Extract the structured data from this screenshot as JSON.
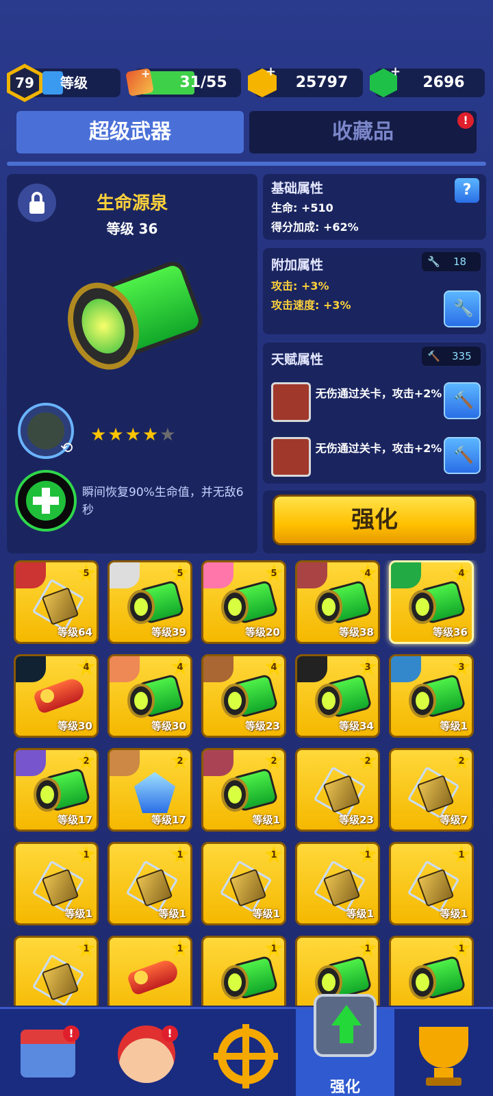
{
  "top_bar": {
    "level": "79",
    "level_label": "等级",
    "energy": "31/55",
    "energy_fill": 0.56,
    "gold": "25797",
    "gems": "2696"
  },
  "tabs": [
    {
      "label": "超级武器",
      "active": true
    },
    {
      "label": "收藏品",
      "active": false
    }
  ],
  "weapon": {
    "name": "生命源泉",
    "level": "等级 36",
    "stars": 4,
    "max_stars": 5,
    "skill": "瞬间恢复90%生命值，并无敌6秒"
  },
  "base_attrs": {
    "title": "基础属性",
    "help": "?",
    "lines": [
      "生命: +510",
      "得分加成: +62%"
    ]
  },
  "extra_attrs": {
    "title": "附加属性",
    "count": "18",
    "lines": [
      "攻击: +3%",
      "攻击速度: +3%"
    ]
  },
  "talent_attrs": {
    "title": "天赋属性",
    "count": "335",
    "items": [
      "无伤通过关卡，攻击+2%",
      "无伤通过关卡，攻击+2%"
    ]
  },
  "upgrade_button": "强化",
  "cards": [
    {
      "lv": "等级64",
      "stars": "5",
      "item": "gun",
      "avatar": "#c33"
    },
    {
      "lv": "等级39",
      "stars": "5",
      "item": "can",
      "avatar": "#ddd"
    },
    {
      "lv": "等级20",
      "stars": "5",
      "item": "can",
      "avatar": "#f7a"
    },
    {
      "lv": "等级38",
      "stars": "4",
      "item": "can",
      "avatar": "#a44"
    },
    {
      "lv": "等级36",
      "stars": "4",
      "item": "can",
      "avatar": "#2a4"
    },
    {
      "lv": "等级30",
      "stars": "4",
      "item": "rocket",
      "avatar": "#123"
    },
    {
      "lv": "等级30",
      "stars": "4",
      "item": "can",
      "avatar": "#e85"
    },
    {
      "lv": "等级23",
      "stars": "4",
      "item": "can",
      "avatar": "#a63"
    },
    {
      "lv": "等级34",
      "stars": "3",
      "item": "can",
      "avatar": "#222"
    },
    {
      "lv": "等级1",
      "stars": "3",
      "item": "can",
      "avatar": "#38c"
    },
    {
      "lv": "等级17",
      "stars": "2",
      "item": "can",
      "avatar": "#75c"
    },
    {
      "lv": "等级17",
      "stars": "2",
      "item": "crystal",
      "avatar": "#c84"
    },
    {
      "lv": "等级1",
      "stars": "2",
      "item": "can",
      "avatar": "#a45"
    },
    {
      "lv": "等级23",
      "stars": "2",
      "item": "gun",
      "avatar": ""
    },
    {
      "lv": "等级7",
      "stars": "2",
      "item": "gun",
      "avatar": ""
    },
    {
      "lv": "等级1",
      "stars": "1",
      "item": "gun",
      "avatar": ""
    },
    {
      "lv": "等级1",
      "stars": "1",
      "item": "gun",
      "avatar": ""
    },
    {
      "lv": "等级1",
      "stars": "1",
      "item": "gun",
      "avatar": ""
    },
    {
      "lv": "等级1",
      "stars": "1",
      "item": "gun",
      "avatar": ""
    },
    {
      "lv": "等级1",
      "stars": "1",
      "item": "gun",
      "avatar": ""
    },
    {
      "lv": "",
      "stars": "1",
      "item": "gun",
      "avatar": ""
    },
    {
      "lv": "",
      "stars": "1",
      "item": "rocket",
      "avatar": ""
    },
    {
      "lv": "",
      "stars": "1",
      "item": "can",
      "avatar": ""
    },
    {
      "lv": "",
      "stars": "1",
      "item": "can",
      "avatar": ""
    },
    {
      "lv": "",
      "stars": "1",
      "item": "can",
      "avatar": ""
    }
  ],
  "bottom_nav": [
    {
      "name": "shop",
      "label": "",
      "badge": true
    },
    {
      "name": "heroes",
      "label": "",
      "badge": true
    },
    {
      "name": "play",
      "label": "",
      "badge": false
    },
    {
      "name": "upgrade",
      "label": "强化",
      "badge": false,
      "active": true
    },
    {
      "name": "trophy",
      "label": "",
      "badge": false
    }
  ]
}
